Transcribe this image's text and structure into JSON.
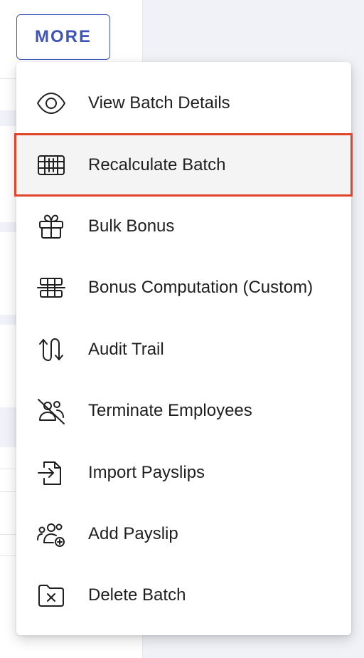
{
  "more_button": {
    "label": "MORE"
  },
  "menu": {
    "items": [
      {
        "label": "View Batch Details",
        "icon": "eye-icon"
      },
      {
        "label": "Recalculate Batch",
        "icon": "calculator-grid-icon",
        "highlighted": true
      },
      {
        "label": "Bulk Bonus",
        "icon": "gift-icon"
      },
      {
        "label": "Bonus Computation (Custom)",
        "icon": "computation-grid-icon"
      },
      {
        "label": "Audit Trail",
        "icon": "up-down-arrows-icon"
      },
      {
        "label": "Terminate Employees",
        "icon": "users-off-icon"
      },
      {
        "label": "Import Payslips",
        "icon": "file-import-icon"
      },
      {
        "label": "Add Payslip",
        "icon": "users-add-icon"
      },
      {
        "label": "Delete Batch",
        "icon": "folder-delete-icon"
      }
    ]
  },
  "colors": {
    "accent": "#3f56b8",
    "highlight_border": "#e0442a",
    "highlight_bg": "#f4f4f4"
  }
}
